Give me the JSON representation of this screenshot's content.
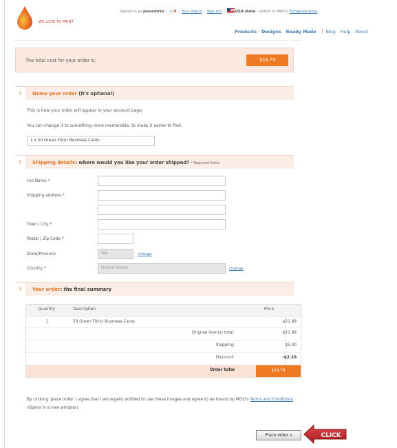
{
  "brand": {
    "tagline": "WE LOVE TO PRINT"
  },
  "signbar": {
    "signed_in_prefix": "Signed in as",
    "username": "jasondirks",
    "cart": "0",
    "your_orders": "Your orders",
    "sign_out": "Sign out",
    "store": "USA store",
    "switch_prefix": "- switch to MOO's",
    "european_store": "European store"
  },
  "nav": [
    "Products",
    "Designs",
    "Ready Made",
    "Blog",
    "Help",
    "About"
  ],
  "cost": {
    "label": "The total cost for your order is:",
    "amount": "$24.79"
  },
  "section1": {
    "num": "1",
    "title": "Name your order",
    "note": "(it's optional)",
    "line1": "This is how your order will appear in your account page.",
    "line2": "You can change it to something more memorable, to make it easier to find.",
    "order_name": "1 x 50 Green Flickr Business Cards"
  },
  "section2": {
    "num": "2",
    "title": "Shipping details",
    "subtitle": ": where would you like your order shipped?",
    "req": "* Required fields",
    "full_name": "Full Name *",
    "address": "Shipping address *",
    "town": "Town / City *",
    "postal": "Postal / Zip Code *",
    "state": "State/Province",
    "state_value": "WA",
    "change1": "change",
    "country": "Country *",
    "country_value": "United States",
    "change2": "change"
  },
  "section3": {
    "num": "3",
    "title": "Your order",
    "subtitle": ": the final summary"
  },
  "summary": {
    "headers": {
      "qty": "Quantity",
      "desc": "Description",
      "price": "Price"
    },
    "item": {
      "qty": "1",
      "desc": "50 Green Flickr Business Cards",
      "price": "$21.99"
    },
    "original_label": "Original item(s) total:",
    "original": "$21.99",
    "shipping_label": "Shipping:",
    "shipping": "$5.00",
    "discount_label": "Discount:",
    "discount": "-$2.20",
    "total_label": "Order total",
    "total": "$24.79"
  },
  "legal": {
    "text": "By clicking 'place order' I agree that I am legally entitled to use these images and agree to be bound by MOO's",
    "terms": "Terms and Conditions",
    "tail": ". (Opens in a new window.)"
  },
  "place_order": "Place order »",
  "click_label": "CLICK",
  "colors": {
    "accent": "#ee7a22",
    "section_bg": "#fbece5",
    "link": "#3a7ab8",
    "arrow": "#c0282b"
  }
}
